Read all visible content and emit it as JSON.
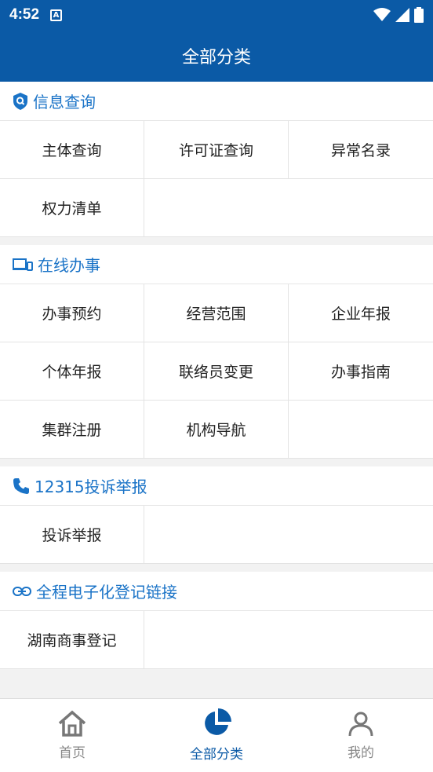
{
  "status": {
    "time": "4:52",
    "notif_letter": "A"
  },
  "header": {
    "title": "全部分类"
  },
  "sections": [
    {
      "title": "信息查询",
      "icon": "search-shield-icon",
      "items": [
        "主体查询",
        "许可证查询",
        "异常名录",
        "权力清单"
      ]
    },
    {
      "title": "在线办事",
      "icon": "devices-icon",
      "items": [
        "办事预约",
        "经营范围",
        "企业年报",
        "个体年报",
        "联络员变更",
        "办事指南",
        "集群注册",
        "机构导航"
      ]
    },
    {
      "title": "12315投诉举报",
      "icon": "phone-icon",
      "items": [
        "投诉举报"
      ]
    },
    {
      "title": "全程电子化登记链接",
      "icon": "link-icon",
      "items": [
        "湖南商事登记"
      ]
    }
  ],
  "tabs": [
    {
      "label": "首页",
      "icon": "home-icon"
    },
    {
      "label": "全部分类",
      "icon": "pie-chart-icon"
    },
    {
      "label": "我的",
      "icon": "user-icon"
    }
  ],
  "colors": {
    "primary": "#0b5aa6",
    "accent": "#1a73c7"
  }
}
